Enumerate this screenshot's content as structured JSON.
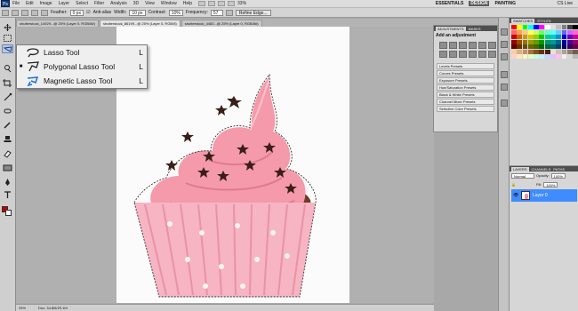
{
  "menubar": {
    "logo": "Ps",
    "items": [
      "File",
      "Edit",
      "Image",
      "Layer",
      "Select",
      "Filter",
      "Analysis",
      "3D",
      "View",
      "Window",
      "Help"
    ],
    "zoom": "33%",
    "workspaces": [
      "ESSENTIALS",
      "DESIGN",
      "PAINTING"
    ],
    "active_workspace": "DESIGN",
    "cs_live": "CS Live"
  },
  "options": {
    "feather_label": "Feather:",
    "feather_value": "0 px",
    "antialias_label": "Anti-alias",
    "width_label": "Width:",
    "width_value": "10 px",
    "contrast_label": "Contrast:",
    "contrast_value": "10%",
    "frequency_label": "Frequency:",
    "frequency_value": "57",
    "refine_label": "Refine Edge..."
  },
  "tabs": [
    {
      "label": "shutterstock_14929...@ 25% (Layer 0, RGB/8#)",
      "active": false
    },
    {
      "label": "shutterstock_86199...@ 25% (Layer 0, RGB/8)",
      "active": true
    },
    {
      "label": "shutterstock_4483...@ 25% (Layer 0, RGB/8#)",
      "active": false
    }
  ],
  "flyout": {
    "items": [
      {
        "label": "Lasso Tool",
        "key": "L",
        "current": false
      },
      {
        "label": "Polygonal Lasso Tool",
        "key": "L",
        "current": true
      },
      {
        "label": "Magnetic Lasso Tool",
        "key": "L",
        "current": false
      }
    ]
  },
  "adjustments": {
    "tabs": [
      "ADJUSTMENTS",
      "MASKS"
    ],
    "title": "Add an adjustment",
    "presets": [
      "Levels Presets",
      "Curves Presets",
      "Exposure Presets",
      "Hue/Saturation Presets",
      "Black & White Presets",
      "Channel Mixer Presets",
      "Selective Color Presets"
    ]
  },
  "swatches": {
    "tabs": [
      "SWATCHES",
      "STYLES"
    ],
    "colors": [
      "#ff0000",
      "#ffff00",
      "#00ff00",
      "#00ffff",
      "#0000ff",
      "#ff00ff",
      "#ffffff",
      "#e0e0e0",
      "#c0c0c0",
      "#808080",
      "#404040",
      "#000000",
      "#ff6666",
      "#ff9966",
      "#ffcc66",
      "#ffff66",
      "#ccff66",
      "#66ff66",
      "#66ffcc",
      "#66ffff",
      "#66ccff",
      "#6666ff",
      "#cc66ff",
      "#ff66cc",
      "#cc0000",
      "#cc6600",
      "#cc9900",
      "#cccc00",
      "#99cc00",
      "#00cc00",
      "#00cc99",
      "#00cccc",
      "#0099cc",
      "#0000cc",
      "#6600cc",
      "#cc0099",
      "#990000",
      "#994c00",
      "#997300",
      "#999900",
      "#669900",
      "#009900",
      "#009966",
      "#009999",
      "#006699",
      "#000099",
      "#4c0099",
      "#990066",
      "#660000",
      "#663300",
      "#664d00",
      "#666600",
      "#446600",
      "#006600",
      "#006644",
      "#006666",
      "#004466",
      "#000066",
      "#330066",
      "#660044",
      "#f5d0a0",
      "#e0b080",
      "#c89060",
      "#a87040",
      "#885020",
      "#683010",
      "#482000",
      "#f0e0d0",
      "#d0c0b0",
      "#b0a090",
      "#908070",
      "#706050",
      "#ffd0d0",
      "#ffe8c0",
      "#fff8c0",
      "#e0ffc0",
      "#c0ffe0",
      "#c0f0ff",
      "#c0d8ff",
      "#e0c0ff",
      "#ffc0f0",
      "#f0f0f0",
      "#d8d8d8",
      "#b8b8b8"
    ]
  },
  "layers": {
    "tabs": [
      "LAYERS",
      "CHANNELS",
      "PATHS"
    ],
    "blend": "Normal",
    "opacity_label": "Opacity:",
    "opacity": "100%",
    "fill_label": "Fill:",
    "fill": "100%",
    "layer_name": "Layer 0"
  },
  "status": {
    "zoom": "25%",
    "doc": "Doc: 34.8M/29.1M"
  },
  "colors": {
    "foreground": "#c00000",
    "background": "#ffffff",
    "selection": "#3f8cff"
  }
}
